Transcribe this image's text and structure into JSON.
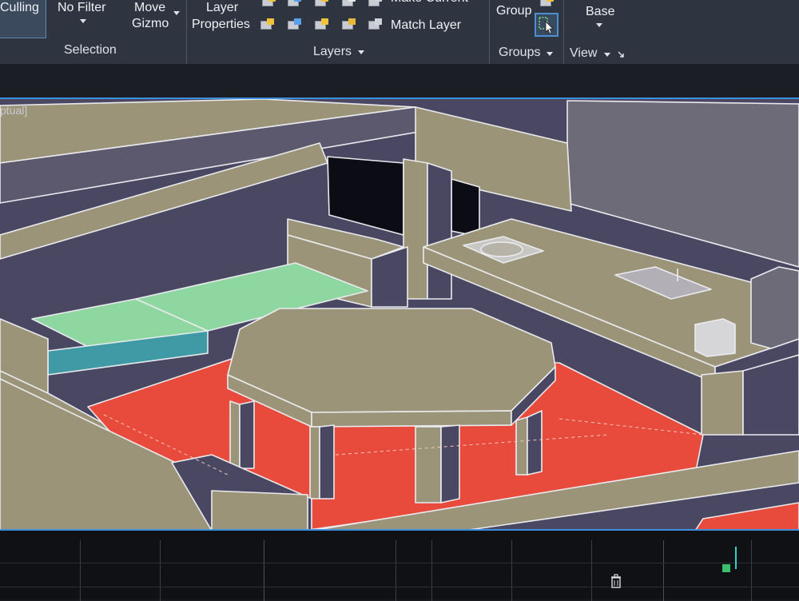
{
  "ribbon": {
    "culling_label": "Culling",
    "filter_label": "No Filter",
    "gizmo_label_1": "Move",
    "gizmo_label_2": "Gizmo",
    "selection_panel": "Selection",
    "layer_props_1": "Layer",
    "layer_props_2": "Properties",
    "make_current": "Make Current",
    "match_layer": "Match Layer",
    "layers_panel": "Layers",
    "group_label": "Group",
    "groups_panel": "Groups",
    "base_label": "Base",
    "view_panel": "View"
  },
  "viewport": {
    "visual_style_label": "ptual]"
  },
  "icons": {
    "select_mode": "select-arrow-icon",
    "trash": "trash-icon",
    "launcher": "dialog-launcher-icon"
  },
  "colors": {
    "ribbon_bg": "#2f3540",
    "accent_blue": "#3d8fe0",
    "floor_red": "#e84a3c",
    "bench_green": "#8fd7a0",
    "furniture_tan": "#9c9479",
    "wall_purple": "#4a4763"
  }
}
